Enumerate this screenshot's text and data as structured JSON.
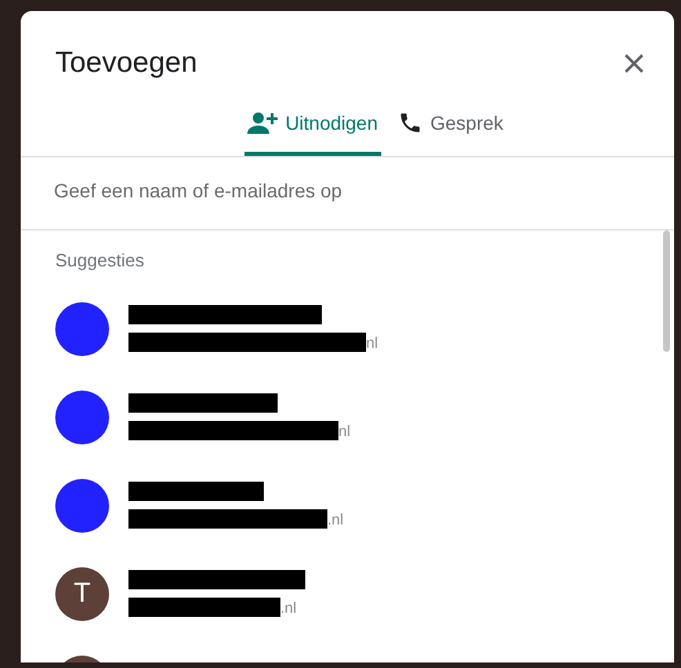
{
  "dialog": {
    "title": "Toevoegen"
  },
  "tabs": [
    {
      "label": "Uitnodigen",
      "selected": true
    },
    {
      "label": "Gesprek",
      "selected": false
    }
  ],
  "search": {
    "placeholder": "Geef een naam of e-mailadres op"
  },
  "suggestions": {
    "heading": "Suggesties",
    "contacts": [
      {
        "kind": "photo",
        "email_suffix": "nl"
      },
      {
        "kind": "photo",
        "email_suffix": "nl"
      },
      {
        "kind": "photo",
        "email_suffix": ".nl"
      },
      {
        "kind": "initial",
        "initial": "T",
        "color": "#5d4037",
        "email_suffix": ".nl"
      },
      {
        "kind": "initial",
        "color": "#5d4037"
      }
    ]
  }
}
